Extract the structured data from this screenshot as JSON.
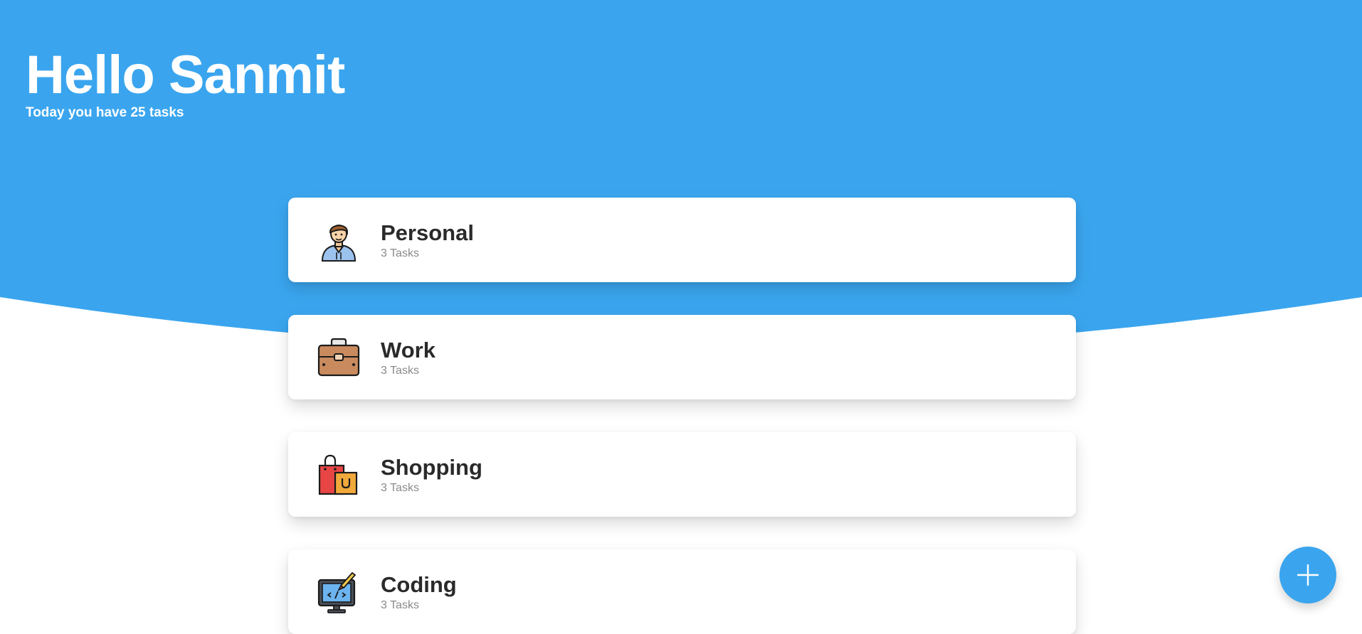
{
  "colors": {
    "accent": "#3aa5ee",
    "background": "#ffffff",
    "card_title": "#2a2a2a",
    "card_count": "#8a8a8a"
  },
  "header": {
    "greeting": "Hello Sanmit",
    "subtitle": "Today you have 25 tasks"
  },
  "categories": [
    {
      "title": "Personal",
      "count": "3 Tasks",
      "icon": "person-avatar-icon"
    },
    {
      "title": "Work",
      "count": "3 Tasks",
      "icon": "briefcase-icon"
    },
    {
      "title": "Shopping",
      "count": "3 Tasks",
      "icon": "shopping-bags-icon"
    },
    {
      "title": "Coding",
      "count": "3 Tasks",
      "icon": "code-monitor-icon"
    }
  ],
  "fab": {
    "icon": "plus-icon"
  }
}
